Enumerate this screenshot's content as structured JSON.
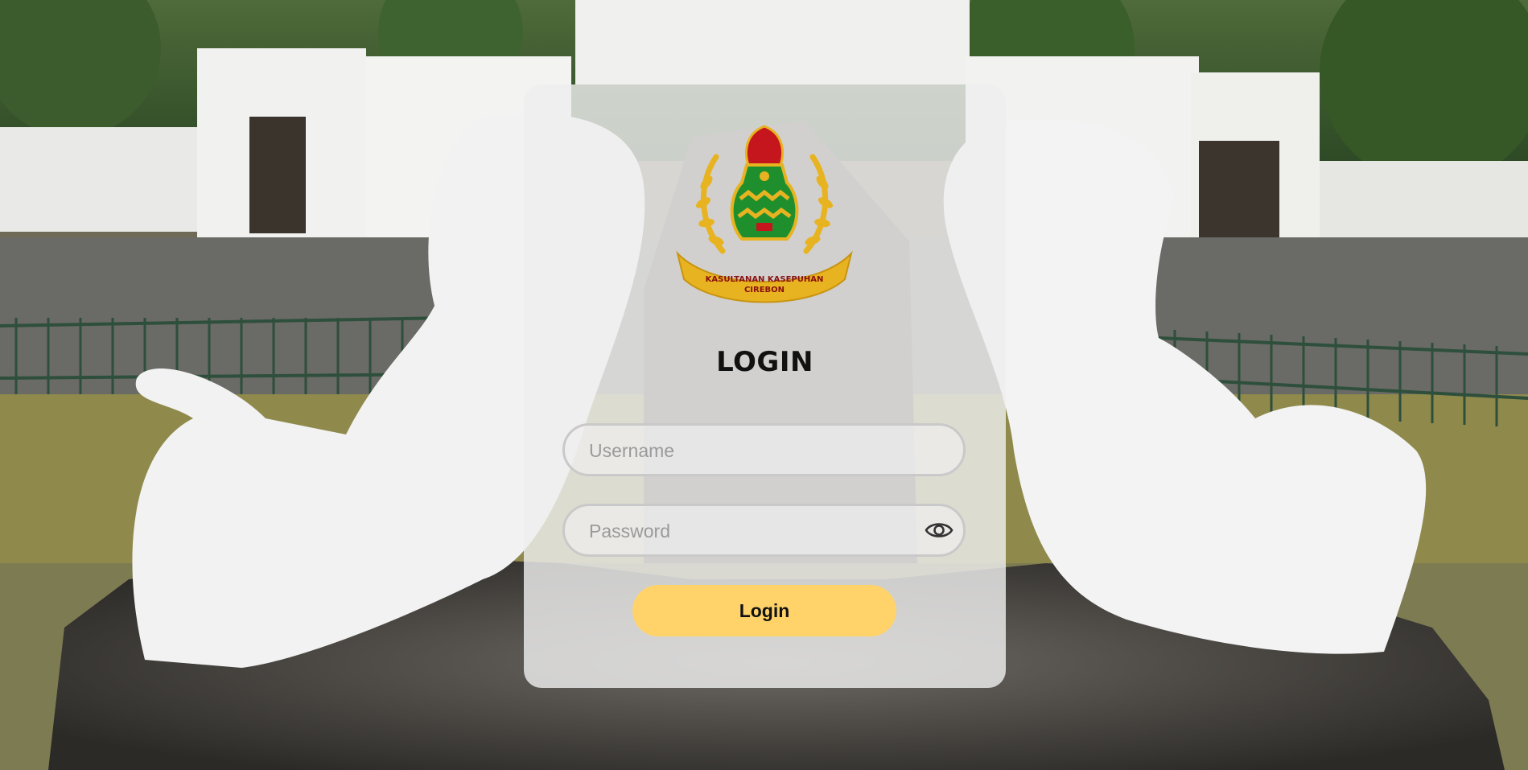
{
  "login": {
    "title": "LOGIN",
    "username_placeholder": "Username",
    "password_placeholder": "Password",
    "button_label": "Login"
  },
  "logo": {
    "ribbon_line1": "KASULTANAN KASEPUHAN",
    "ribbon_line2": "CIREBON"
  },
  "colors": {
    "button": "#ffd36a",
    "card": "#eeeeee",
    "logo_gold": "#e8b320",
    "logo_red": "#c4161c",
    "logo_green": "#1f8f2e"
  },
  "icons": {
    "password_toggle": "eye-icon"
  }
}
